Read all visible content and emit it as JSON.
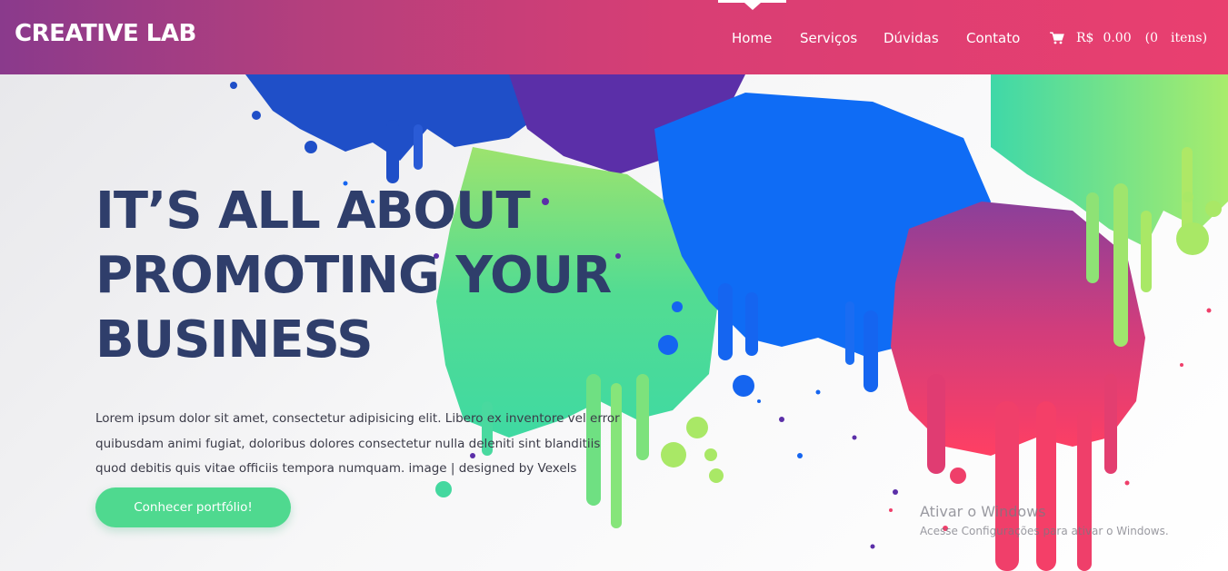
{
  "navbar": {
    "brand": "CREATIVE LAB",
    "links": [
      "Home",
      "Serviços",
      "Dúvidas",
      "Contato"
    ],
    "active": "Home",
    "cart": {
      "currency": "R$",
      "amount": "0.00",
      "count": "(0",
      "items_label": "itens)"
    }
  },
  "hero": {
    "headline_lines": [
      "IT’S ALL ABOUT",
      "PROMOTING YOUR",
      "BUSINESS"
    ],
    "lead_lines": [
      "Lorem ipsum dolor sit amet, consectetur adipisicing elit. Libero ex inventore vel error",
      "quibusdam animi fugiat, doloribus dolores consectetur nulla deleniti sint blanditiis",
      "quod debitis quis vitae officiis tempora numquam. image | designed by Vexels"
    ],
    "cta_label": "Conhecer portfólio!"
  },
  "watermark": {
    "title": "Ativar o Windows",
    "subtitle": "Acesse Configurações para ativar o Windows."
  },
  "colors": {
    "nav_start": "#8a3a8c",
    "nav_end": "#e93f6f",
    "headline": "#2f3e6b",
    "cta": "#4fd98f",
    "paint_blue": "#1e6ff2",
    "paint_green": "#4fdb9a",
    "paint_pink": "#ef3f6d"
  }
}
